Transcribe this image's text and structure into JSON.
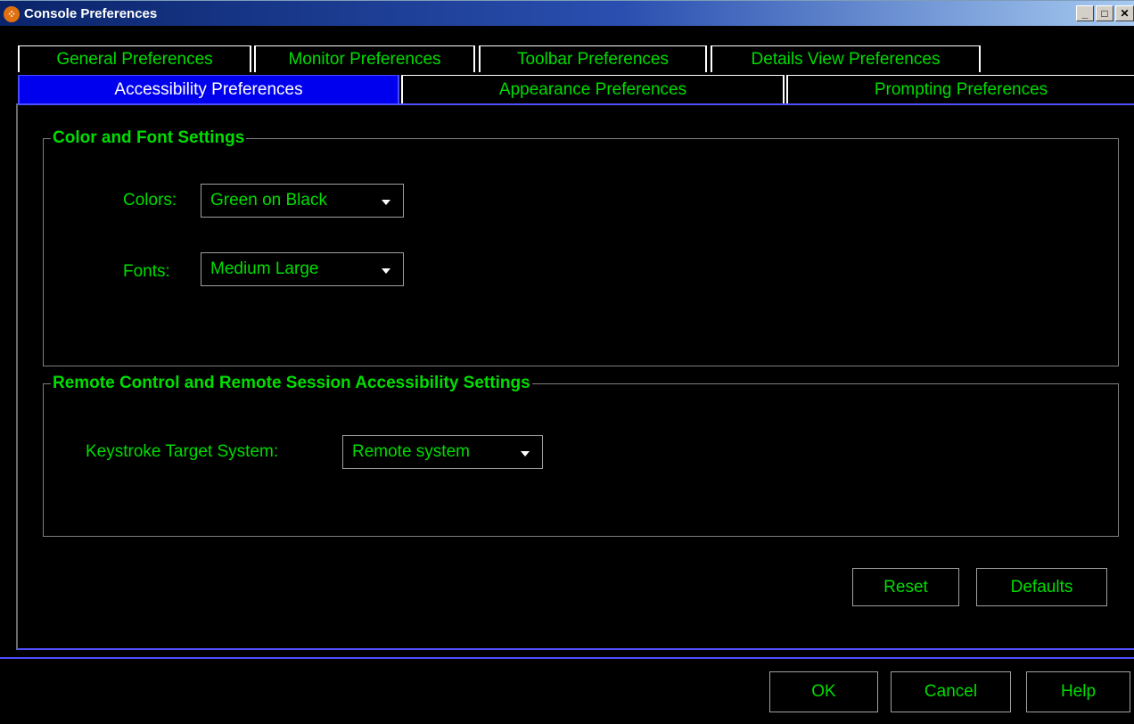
{
  "window": {
    "title": "Console Preferences",
    "icon": "app-icon",
    "controls": [
      "minimize-icon",
      "maximize-icon",
      "close-icon"
    ]
  },
  "tabs": {
    "row1": [
      {
        "label": "General Preferences"
      },
      {
        "label": "Monitor Preferences"
      },
      {
        "label": "Toolbar Preferences"
      },
      {
        "label": "Details View Preferences"
      }
    ],
    "row2": [
      {
        "label": "Accessibility Preferences",
        "active": true
      },
      {
        "label": "Appearance Preferences"
      },
      {
        "label": "Prompting Preferences"
      }
    ]
  },
  "color_font": {
    "title": "Color and Font Settings",
    "colors_label": "Colors:",
    "colors_value": "Green on Black",
    "fonts_label": "Fonts:",
    "fonts_value": "Medium Large"
  },
  "remote": {
    "title": "Remote Control and Remote Session Accessibility Settings",
    "keystroke_label": "Keystroke Target System:",
    "keystroke_value": "Remote system"
  },
  "panel_buttons": {
    "reset": "Reset",
    "defaults": "Defaults"
  },
  "dialog_buttons": {
    "ok": "OK",
    "cancel": "Cancel",
    "help": "Help"
  },
  "colors": {
    "foreground": "#00dd00",
    "background": "#000000",
    "active_tab": "#0000ee",
    "title_bar": "#0a246a"
  }
}
